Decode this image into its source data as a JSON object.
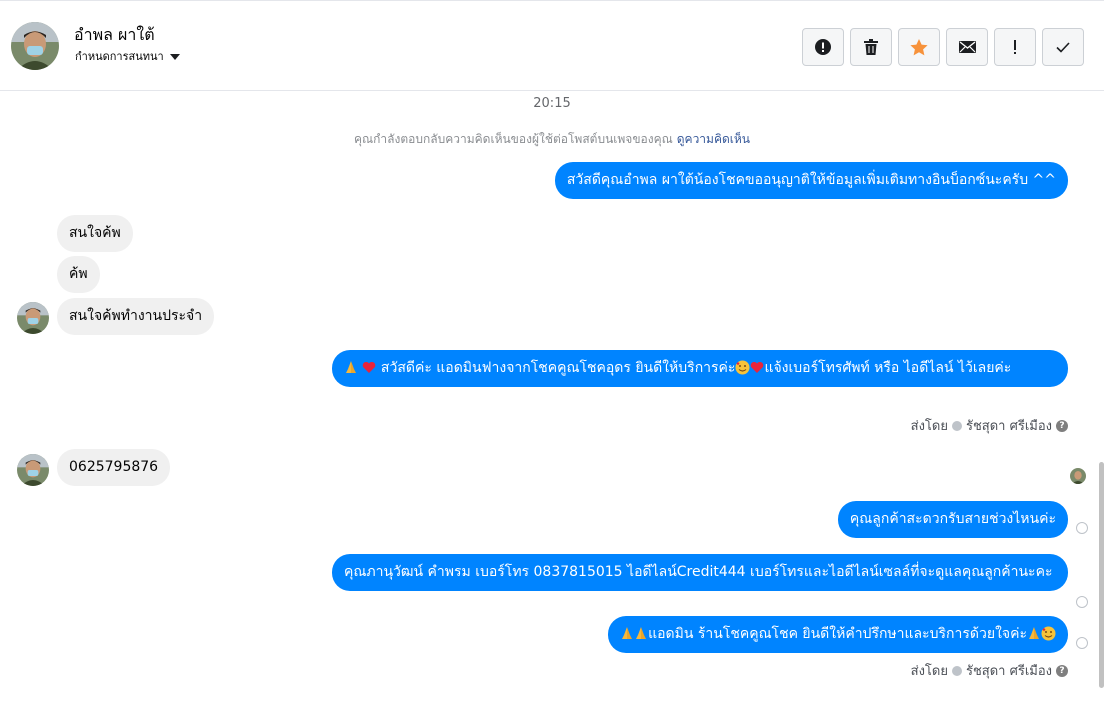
{
  "header": {
    "contact_name": "อำพล ผาใต้",
    "conversation_menu": "กำหนดการสนทนา",
    "actions": [
      {
        "name": "report-button",
        "icon": "alert-circle-icon"
      },
      {
        "name": "delete-button",
        "icon": "trash-icon"
      },
      {
        "name": "star-button",
        "icon": "star-icon",
        "color": "#f7923b"
      },
      {
        "name": "mark-unread-button",
        "icon": "envelope-icon"
      },
      {
        "name": "mark-important-button",
        "icon": "exclamation-icon"
      },
      {
        "name": "mark-done-button",
        "icon": "check-icon"
      }
    ]
  },
  "chat": {
    "timestamp": "20:15",
    "context_text": "คุณกำลังตอบกลับความคิดเห็นของผู้ใช้ต่อโพสต์บนเพจของคุณ",
    "context_link": "ดูความคิดเห็น",
    "messages": [
      {
        "dir": "out",
        "text": "สวัสดีคุณอำพล ผาใต้น้องโชคขออนุญาติให้ข้อมูลเพิ่มเติมทางอินบ็อกซ์นะครับ ^^"
      },
      {
        "dir": "in",
        "text": "สนใจค้พ"
      },
      {
        "dir": "in",
        "text": "ค้พ"
      },
      {
        "dir": "in",
        "text": "สนใจค้พทำงานประจำ"
      },
      {
        "dir": "out",
        "text_a": "สวัสดีค่ะ แอดมินฟางจากโชคคูณโชคอุดร ยินดีให้บริการค่ะ",
        "text_b": "แจ้งเบอร์โทรศัพท์ หรือ ไอดีไลน์  ไว้เลยค่ะ"
      },
      {
        "dir": "in",
        "text": "0625795876"
      },
      {
        "dir": "out",
        "text": "คุณลูกค้าสะดวกรับสายช่วงไหนค่ะ"
      },
      {
        "dir": "out",
        "text": "คุณภานุวัฒน์ คำพรม       เบอร์โทร 0837815015  ไอดีไลน์Credit444   เบอร์โทรและไอดีไลน์เซลล์ที่จะดูแลคุณลูกค้านะคะ"
      },
      {
        "dir": "out",
        "text": "แอดมิน ร้านโชคคูณโชค ยินดีให้คำปรึกษาและบริการด้วยใจค่ะ"
      }
    ],
    "sent_by_label": "ส่งโดย",
    "sent_by_name": "รัชสุดา ศรีเมือง",
    "help_glyph": "?"
  },
  "colors": {
    "outgoing_bubble": "#0084ff",
    "incoming_bubble": "#f0f0f0",
    "link": "#365899"
  }
}
